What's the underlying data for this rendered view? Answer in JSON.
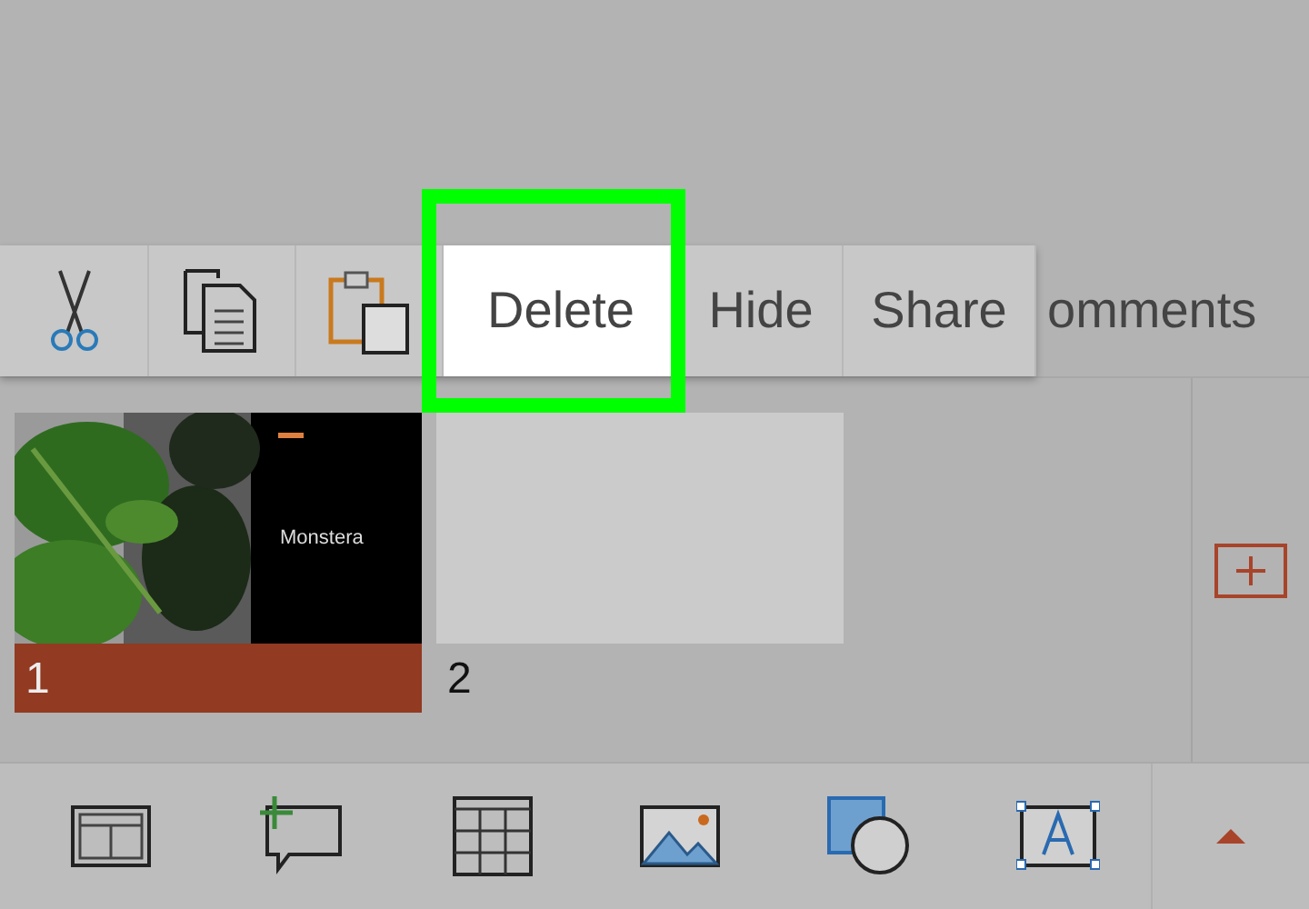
{
  "context_menu": {
    "items": [
      {
        "kind": "icon",
        "selected": false,
        "highlighted": false
      },
      {
        "kind": "icon",
        "selected": false,
        "highlighted": false
      },
      {
        "kind": "icon",
        "selected": false,
        "highlighted": false
      },
      {
        "kind": "text",
        "label": "Delete",
        "selected": true,
        "highlighted": true
      },
      {
        "kind": "text",
        "label": "Hide",
        "selected": false,
        "highlighted": false
      },
      {
        "kind": "text",
        "label": "Share",
        "selected": false,
        "highlighted": false
      }
    ]
  },
  "behind_menu_text": "omments",
  "slides": [
    {
      "number": "1",
      "kind": "picture",
      "title": "Monstera",
      "selected": true
    },
    {
      "number": "2",
      "kind": "blank",
      "selected": false
    }
  ],
  "ribbon": {
    "expanded": false
  }
}
